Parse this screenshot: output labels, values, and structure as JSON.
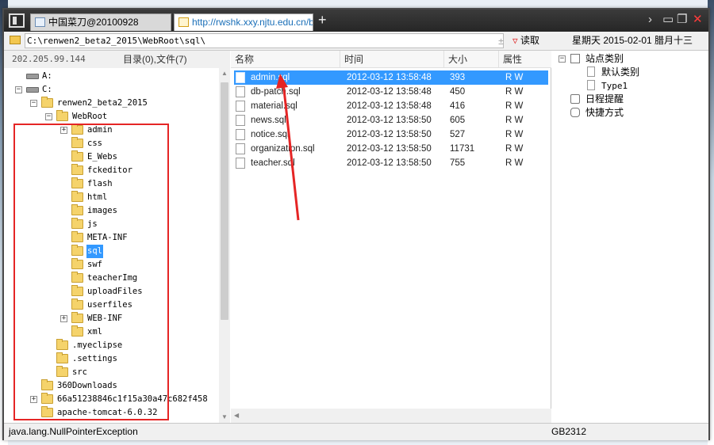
{
  "tabs": [
    {
      "label": "中国菜刀@20100928"
    },
    {
      "label": "http://rwshk.xxy.njtu.edu.cn/b..."
    }
  ],
  "tabbar": {
    "add_label": "+",
    "controls": [
      "›",
      "▭",
      "❐",
      "✕"
    ]
  },
  "addressbar": {
    "path": "C:\\renwen2_beta2_2015\\WebRoot\\sql\\",
    "plusminus": "±",
    "dropdown": "▽",
    "read_label": "读取",
    "date": "星期天 2015-02-01 腊月十三"
  },
  "leftpane": {
    "ip": "202.205.99.144",
    "summary": "目录(0),文件(7)",
    "tree": [
      {
        "label": "A:",
        "type": "drive",
        "depth": 0,
        "expander": ""
      },
      {
        "label": "C:",
        "type": "drive",
        "depth": 0,
        "expander": "−"
      },
      {
        "label": "renwen2_beta2_2015",
        "type": "folder",
        "depth": 1,
        "expander": "−"
      },
      {
        "label": "WebRoot",
        "type": "folder",
        "depth": 2,
        "expander": "−"
      },
      {
        "label": "admin",
        "type": "folder",
        "depth": 3,
        "expander": "+"
      },
      {
        "label": "css",
        "type": "folder",
        "depth": 3,
        "expander": ""
      },
      {
        "label": "E_Webs",
        "type": "folder",
        "depth": 3,
        "expander": ""
      },
      {
        "label": "fckeditor",
        "type": "folder",
        "depth": 3,
        "expander": ""
      },
      {
        "label": "flash",
        "type": "folder",
        "depth": 3,
        "expander": ""
      },
      {
        "label": "html",
        "type": "folder",
        "depth": 3,
        "expander": ""
      },
      {
        "label": "images",
        "type": "folder",
        "depth": 3,
        "expander": ""
      },
      {
        "label": "js",
        "type": "folder",
        "depth": 3,
        "expander": ""
      },
      {
        "label": "META-INF",
        "type": "folder",
        "depth": 3,
        "expander": ""
      },
      {
        "label": "sql",
        "type": "folder",
        "depth": 3,
        "expander": "",
        "selected": true
      },
      {
        "label": "swf",
        "type": "folder",
        "depth": 3,
        "expander": ""
      },
      {
        "label": "teacherImg",
        "type": "folder",
        "depth": 3,
        "expander": ""
      },
      {
        "label": "uploadFiles",
        "type": "folder",
        "depth": 3,
        "expander": ""
      },
      {
        "label": "userfiles",
        "type": "folder",
        "depth": 3,
        "expander": ""
      },
      {
        "label": "WEB-INF",
        "type": "folder",
        "depth": 3,
        "expander": "+"
      },
      {
        "label": "xml",
        "type": "folder",
        "depth": 3,
        "expander": ""
      },
      {
        "label": ".myeclipse",
        "type": "folder",
        "depth": 2,
        "expander": ""
      },
      {
        "label": ".settings",
        "type": "folder",
        "depth": 2,
        "expander": ""
      },
      {
        "label": "src",
        "type": "folder",
        "depth": 2,
        "expander": ""
      },
      {
        "label": "360Downloads",
        "type": "folder",
        "depth": 1,
        "expander": ""
      },
      {
        "label": "66a51238846c1f15a30a47c682f458",
        "type": "folder",
        "depth": 1,
        "expander": "+"
      },
      {
        "label": "apache-tomcat-6.0.32",
        "type": "folder",
        "depth": 1,
        "expander": ""
      }
    ]
  },
  "filepane": {
    "columns": {
      "name": "名称",
      "time": "时间",
      "size": "大小",
      "attr": "属性"
    },
    "files": [
      {
        "name": "admin.sql",
        "time": "2012-03-12 13:58:48",
        "size": "393",
        "attr": "R W",
        "selected": true
      },
      {
        "name": "db-patch.sql",
        "time": "2012-03-12 13:58:48",
        "size": "450",
        "attr": "R W"
      },
      {
        "name": "material.sql",
        "time": "2012-03-12 13:58:48",
        "size": "416",
        "attr": "R W"
      },
      {
        "name": "news.sql",
        "time": "2012-03-12 13:58:50",
        "size": "605",
        "attr": "R W"
      },
      {
        "name": "notice.sql",
        "time": "2012-03-12 13:58:50",
        "size": "527",
        "attr": "R W"
      },
      {
        "name": "organization.sql",
        "time": "2012-03-12 13:58:50",
        "size": "11731",
        "attr": "R W"
      },
      {
        "name": "teacher.sql",
        "time": "2012-03-12 13:58:50",
        "size": "755",
        "attr": "R W"
      }
    ]
  },
  "rightpane": {
    "site_category": "站点类别",
    "default_category": "默认类别",
    "type1": "Type1",
    "schedule": "日程提醒",
    "shortcuts": "快捷方式"
  },
  "statusbar": {
    "message": "java.lang.NullPointerException",
    "encoding": "GB2312"
  },
  "colors": {
    "accent": "#3399ff",
    "annotation": "#e52525"
  }
}
